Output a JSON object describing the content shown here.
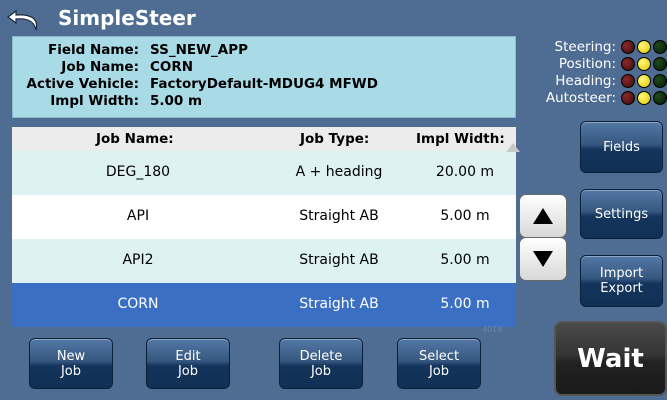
{
  "app": {
    "title": "SimpleSteer"
  },
  "info": {
    "field_name_label": "Field Name:",
    "field_name_value": "SS_NEW_APP",
    "job_name_label": "Job Name:",
    "job_name_value": "CORN",
    "active_vehicle_label": "Active Vehicle:",
    "active_vehicle_value": "FactoryDefault-MDUG4 MFWD",
    "impl_width_label": "Impl Width:",
    "impl_width_value": "5.00 m"
  },
  "status": [
    {
      "label": "Steering:",
      "leds": [
        "red",
        "yellow",
        "green"
      ]
    },
    {
      "label": "Position:",
      "leds": [
        "red",
        "yellow",
        "green"
      ]
    },
    {
      "label": "Heading:",
      "leds": [
        "red",
        "yellow",
        "green"
      ]
    },
    {
      "label": "Autosteer:",
      "leds": [
        "red",
        "yellow",
        "green"
      ]
    }
  ],
  "table": {
    "headers": [
      "Job Name:",
      "Job Type:",
      "Impl Width:"
    ],
    "rows": [
      {
        "name": "DEG_180",
        "type": "A + heading",
        "width": "20.00 m"
      },
      {
        "name": "API",
        "type": "Straight AB",
        "width": "5.00 m"
      },
      {
        "name": "API2",
        "type": "Straight AB",
        "width": "5.00 m"
      },
      {
        "name": "CORN",
        "type": "Straight AB",
        "width": "5.00 m"
      }
    ],
    "selected_row": 3
  },
  "side_buttons": {
    "fields": "Fields",
    "settings": "Settings",
    "import_line1": "Import",
    "import_line2": "Export"
  },
  "bottom_buttons": {
    "new_line1": "New",
    "new_line2": "Job",
    "edit_line1": "Edit",
    "edit_line2": "Job",
    "delete_line1": "Delete",
    "delete_line2": "Job",
    "select_line1": "Select",
    "select_line2": "Job"
  },
  "wait_label": "Wait",
  "watermark": "4019"
}
